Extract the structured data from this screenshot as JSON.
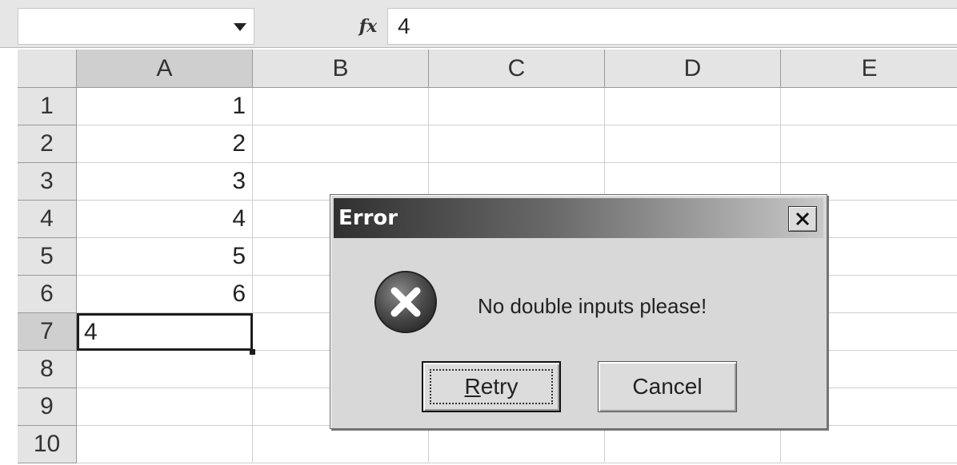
{
  "formula_bar": {
    "name_box_value": "",
    "fx_label": "fx",
    "formula_value": "4"
  },
  "sheet": {
    "columns": [
      "A",
      "B",
      "C",
      "D",
      "E"
    ],
    "rows": [
      "1",
      "2",
      "3",
      "4",
      "5",
      "6",
      "7",
      "8",
      "9",
      "10"
    ],
    "cells": {
      "A1": "1",
      "A2": "2",
      "A3": "3",
      "A4": "4",
      "A5": "5",
      "A6": "6",
      "A7": "4"
    },
    "active_cell": "A7"
  },
  "dialog": {
    "title": "Error",
    "close_label": "×",
    "message": "No double inputs please!",
    "retry_label_first": "R",
    "retry_label_rest": "etry",
    "cancel_label": "Cancel",
    "icon": "error-x-icon"
  }
}
